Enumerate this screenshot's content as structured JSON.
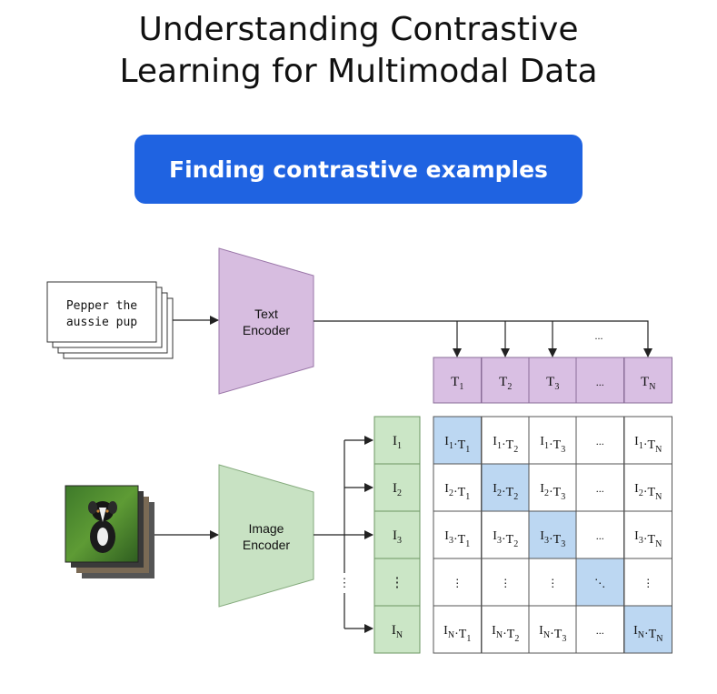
{
  "title": {
    "line1": "Understanding Contrastive",
    "line2": "Learning for Multimodal Data"
  },
  "badge": {
    "label": "Finding contrastive examples"
  },
  "text_input": {
    "line1": "Pepper the",
    "line2": "aussie pup"
  },
  "image_input": {
    "subject": "photo of a black and white puppy on grass"
  },
  "text_encoder": {
    "line1": "Text",
    "line2": "Encoder",
    "color": "#d7bde0"
  },
  "image_encoder": {
    "line1": "Image",
    "line2": "Encoder",
    "color": "#c8e2c3"
  },
  "arrow_ellipsis": "...",
  "vdots": "⋮",
  "text_embeddings": [
    {
      "base": "T",
      "sub": "1"
    },
    {
      "base": "T",
      "sub": "2"
    },
    {
      "base": "T",
      "sub": "3"
    },
    {
      "base": "...",
      "sub": ""
    },
    {
      "base": "T",
      "sub": "N"
    }
  ],
  "image_embeddings": [
    {
      "base": "I",
      "sub": "1"
    },
    {
      "base": "I",
      "sub": "2"
    },
    {
      "base": "I",
      "sub": "3"
    },
    {
      "base": "⋮",
      "sub": ""
    },
    {
      "base": "I",
      "sub": "N"
    }
  ],
  "matrix": {
    "rows": [
      [
        "I1·T1",
        "I1·T2",
        "I1·T3",
        "...",
        "I1·TN"
      ],
      [
        "I2·T1",
        "I2·T2",
        "I2·T3",
        "...",
        "I2·TN"
      ],
      [
        "I3·T1",
        "I3·T2",
        "I3·T3",
        "...",
        "I3·TN"
      ],
      [
        "⋮",
        "⋮",
        "⋮",
        "⋱",
        "⋮"
      ],
      [
        "IN·T1",
        "IN·T2",
        "IN·T3",
        "...",
        "IN·TN"
      ]
    ],
    "highlighted": [
      [
        0,
        0
      ],
      [
        1,
        1
      ],
      [
        2,
        2
      ],
      [
        3,
        3
      ],
      [
        4,
        4
      ]
    ]
  },
  "colors": {
    "badge": "#1f63e1",
    "text_embedding_fill": "#d9bfe3",
    "image_embedding_fill": "#cbe6c6",
    "highlight": "#bcd7f2"
  }
}
